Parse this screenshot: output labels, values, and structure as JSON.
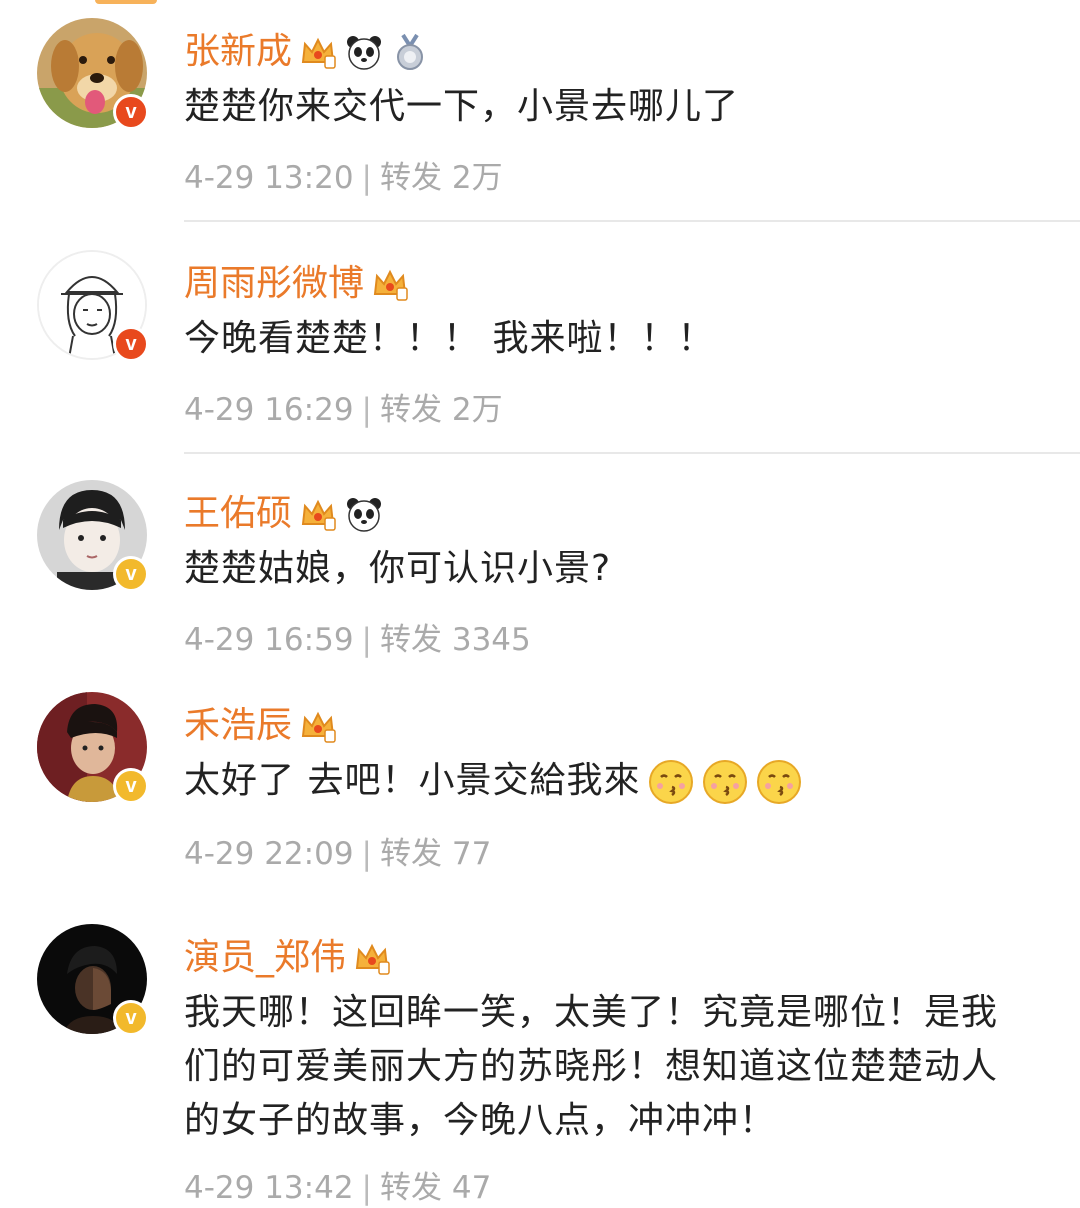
{
  "comments": [
    {
      "name": "张新成",
      "badges": [
        "crown-icon",
        "panda-icon",
        "medal-icon"
      ],
      "verified": "red",
      "avatar": "golden-retriever-avatar",
      "text": "楚楚你来交代一下，小景去哪儿了",
      "date": "4-29 13:20",
      "sep": "|",
      "repost_label": "转发",
      "repost_count": "2万"
    },
    {
      "name": "周雨彤微博",
      "badges": [
        "crown-icon"
      ],
      "verified": "red",
      "avatar": "cartoon-girl-avatar",
      "text": "今晚看楚楚！！！ 我来啦！！！",
      "date": "4-29 16:29",
      "sep": "|",
      "repost_label": "转发",
      "repost_count": "2万"
    },
    {
      "name": "王佑硕",
      "badges": [
        "crown-icon",
        "panda-icon"
      ],
      "verified": "gold",
      "avatar": "child-avatar",
      "text": "楚楚姑娘，你可认识小景?",
      "date": "4-29 16:59",
      "sep": "|",
      "repost_label": "转发",
      "repost_count": "3345"
    },
    {
      "name": "禾浩辰",
      "badges": [
        "crown-icon"
      ],
      "verified": "gold",
      "avatar": "man-portrait-avatar",
      "text": "太好了 去吧！小景交給我來",
      "emojis": [
        "kiss-emoji-icon",
        "kiss-emoji-icon",
        "kiss-emoji-icon"
      ],
      "date": "4-29 22:09",
      "sep": "|",
      "repost_label": "转发",
      "repost_count": "77"
    },
    {
      "name": "演员_郑伟",
      "badges": [
        "crown-icon"
      ],
      "verified": "gold",
      "avatar": "dark-portrait-avatar",
      "text": "我天哪！这回眸一笑，太美了！究竟是哪位！是我们的可爱美丽大方的苏晓彤！想知道这位楚楚动人的女子的故事，今晚八点，冲冲冲！",
      "date": "4-29 13:42",
      "sep": "|",
      "repost_label": "转发",
      "repost_count": "47"
    }
  ],
  "colors": {
    "name": "#ea7a2a",
    "meta": "#aaaaaa",
    "verified_red": "#e8491d",
    "verified_gold": "#f2b92c"
  }
}
